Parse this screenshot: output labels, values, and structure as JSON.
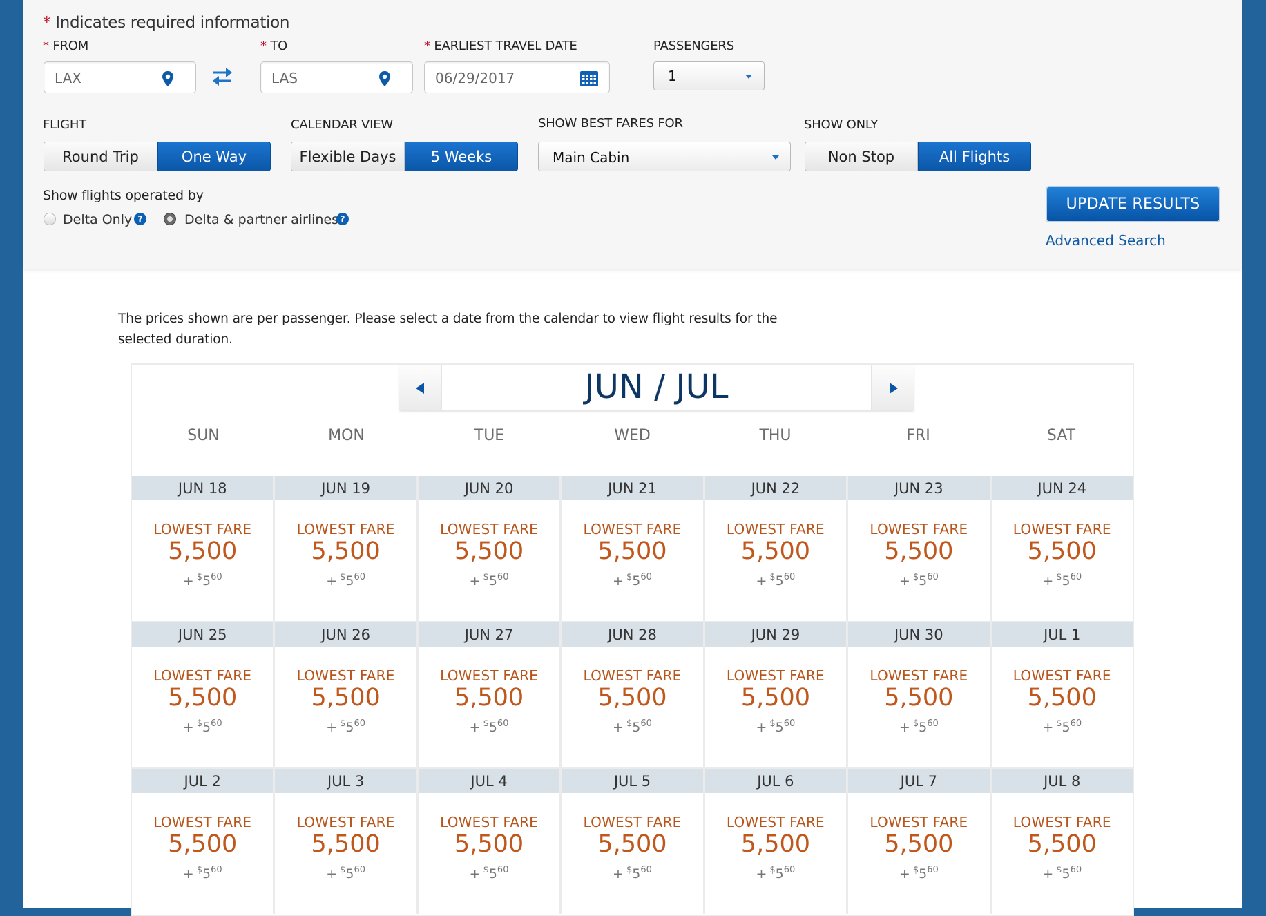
{
  "form": {
    "required_note": "Indicates required information",
    "required_mark": "*",
    "from": {
      "label": "FROM",
      "value": "LAX",
      "icon": "location-pin-icon"
    },
    "swap_icon": "swap-arrows-icon",
    "to": {
      "label": "TO",
      "value": "LAS",
      "icon": "location-pin-icon"
    },
    "date": {
      "label": "EARLIEST TRAVEL DATE",
      "value": "06/29/2017",
      "icon": "calendar-icon"
    },
    "passengers": {
      "label": "PASSENGERS",
      "value": "1"
    },
    "flight": {
      "label": "FLIGHT",
      "options": [
        "Round Trip",
        "One Way"
      ],
      "selected": "One Way"
    },
    "calendar_view": {
      "label": "CALENDAR VIEW",
      "options": [
        "Flexible Days",
        "5 Weeks"
      ],
      "selected": "5 Weeks"
    },
    "best_fares": {
      "label": "SHOW BEST FARES FOR",
      "value": "Main Cabin"
    },
    "show_only": {
      "label": "SHOW ONLY",
      "options": [
        "Non Stop",
        "All Flights"
      ],
      "selected": "All Flights"
    },
    "operated_by": {
      "label": "Show flights operated by",
      "options": [
        {
          "label": "Delta Only",
          "checked": false
        },
        {
          "label": "Delta & partner airlines",
          "checked": true
        }
      ],
      "help_glyph": "?"
    },
    "update_button": "UPDATE RESULTS",
    "advanced_search": "Advanced Search"
  },
  "info_text": "The prices shown are per passenger. Please select a date from the calendar to view flight results for the selected duration.",
  "calendar": {
    "month_label": "JUN / JUL",
    "weekdays": [
      "SUN",
      "MON",
      "TUE",
      "WED",
      "THU",
      "FRI",
      "SAT"
    ],
    "weeks": [
      [
        {
          "date": "JUN 18",
          "label": "LOWEST FARE",
          "miles": "5,500",
          "tax_dollars": "5",
          "tax_cents": "60"
        },
        {
          "date": "JUN 19",
          "label": "LOWEST FARE",
          "miles": "5,500",
          "tax_dollars": "5",
          "tax_cents": "60"
        },
        {
          "date": "JUN 20",
          "label": "LOWEST FARE",
          "miles": "5,500",
          "tax_dollars": "5",
          "tax_cents": "60"
        },
        {
          "date": "JUN 21",
          "label": "LOWEST FARE",
          "miles": "5,500",
          "tax_dollars": "5",
          "tax_cents": "60"
        },
        {
          "date": "JUN 22",
          "label": "LOWEST FARE",
          "miles": "5,500",
          "tax_dollars": "5",
          "tax_cents": "60"
        },
        {
          "date": "JUN 23",
          "label": "LOWEST FARE",
          "miles": "5,500",
          "tax_dollars": "5",
          "tax_cents": "60"
        },
        {
          "date": "JUN 24",
          "label": "LOWEST FARE",
          "miles": "5,500",
          "tax_dollars": "5",
          "tax_cents": "60"
        }
      ],
      [
        {
          "date": "JUN 25",
          "label": "LOWEST FARE",
          "miles": "5,500",
          "tax_dollars": "5",
          "tax_cents": "60"
        },
        {
          "date": "JUN 26",
          "label": "LOWEST FARE",
          "miles": "5,500",
          "tax_dollars": "5",
          "tax_cents": "60"
        },
        {
          "date": "JUN 27",
          "label": "LOWEST FARE",
          "miles": "5,500",
          "tax_dollars": "5",
          "tax_cents": "60"
        },
        {
          "date": "JUN 28",
          "label": "LOWEST FARE",
          "miles": "5,500",
          "tax_dollars": "5",
          "tax_cents": "60"
        },
        {
          "date": "JUN 29",
          "label": "LOWEST FARE",
          "miles": "5,500",
          "tax_dollars": "5",
          "tax_cents": "60"
        },
        {
          "date": "JUN 30",
          "label": "LOWEST FARE",
          "miles": "5,500",
          "tax_dollars": "5",
          "tax_cents": "60"
        },
        {
          "date": "JUL 1",
          "label": "LOWEST FARE",
          "miles": "5,500",
          "tax_dollars": "5",
          "tax_cents": "60"
        }
      ],
      [
        {
          "date": "JUL 2",
          "label": "LOWEST FARE",
          "miles": "5,500",
          "tax_dollars": "5",
          "tax_cents": "60"
        },
        {
          "date": "JUL 3",
          "label": "LOWEST FARE",
          "miles": "5,500",
          "tax_dollars": "5",
          "tax_cents": "60"
        },
        {
          "date": "JUL 4",
          "label": "LOWEST FARE",
          "miles": "5,500",
          "tax_dollars": "5",
          "tax_cents": "60"
        },
        {
          "date": "JUL 5",
          "label": "LOWEST FARE",
          "miles": "5,500",
          "tax_dollars": "5",
          "tax_cents": "60"
        },
        {
          "date": "JUL 6",
          "label": "LOWEST FARE",
          "miles": "5,500",
          "tax_dollars": "5",
          "tax_cents": "60"
        },
        {
          "date": "JUL 7",
          "label": "LOWEST FARE",
          "miles": "5,500",
          "tax_dollars": "5",
          "tax_cents": "60"
        },
        {
          "date": "JUL 8",
          "label": "LOWEST FARE",
          "miles": "5,500",
          "tax_dollars": "5",
          "tax_cents": "60"
        }
      ]
    ],
    "tax_prefix": "+",
    "currency_symbol": "$"
  },
  "colors": {
    "frame_blue": "#22639c",
    "accent_blue": "#0b57a8",
    "fare_orange": "#c0581d",
    "required_red": "#c0162d",
    "date_header_bg": "#d8e0e8",
    "month_navy": "#0d3663"
  }
}
